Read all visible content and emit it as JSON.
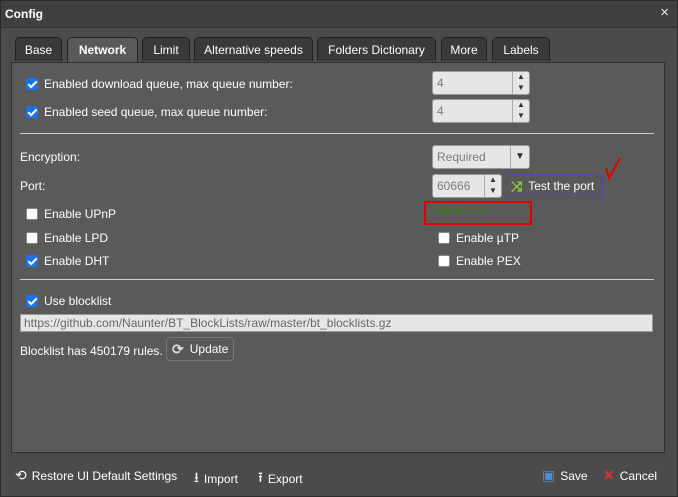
{
  "window": {
    "title": "Config",
    "close_symbol": "×"
  },
  "tabs": [
    {
      "label": "Base"
    },
    {
      "label": "Network",
      "active": true
    },
    {
      "label": "Limit"
    },
    {
      "label": "Alternative speeds"
    },
    {
      "label": "Folders Dictionary"
    },
    {
      "label": "More"
    },
    {
      "label": "Labels"
    }
  ],
  "queue": {
    "download": {
      "label": "Enabled download queue, max queue number:",
      "checked": true,
      "value": "4"
    },
    "seed": {
      "label": "Enabled seed queue, max queue number:",
      "checked": true,
      "value": "4"
    }
  },
  "encryption": {
    "label": "Encryption:",
    "value": "Required"
  },
  "port": {
    "label": "Port:",
    "value": "60666",
    "test_button": "Test the port",
    "status": "Port is open"
  },
  "options": {
    "upnp": {
      "label": "Enable UPnP",
      "checked": false
    },
    "lpd": {
      "label": "Enable LPD",
      "checked": false
    },
    "dht": {
      "label": "Enable DHT",
      "checked": true
    },
    "utp": {
      "label": "Enable µTP",
      "checked": false
    },
    "pex": {
      "label": "Enable PEX",
      "checked": false
    }
  },
  "blocklist": {
    "label": "Use blocklist",
    "checked": true,
    "url": "https://github.com/Naunter/BT_BlockLists/raw/master/bt_blocklists.gz",
    "info": "Blocklist has 450179 rules.",
    "update_button": "Update"
  },
  "footer": {
    "restore": "Restore UI Default Settings",
    "import": "Import",
    "export": "Export",
    "save": "Save",
    "cancel": "Cancel"
  },
  "colors": {
    "accent_green": "#8cd13c",
    "annotation_red": "#e00000",
    "checkbox_blue": "#1a73e8"
  }
}
